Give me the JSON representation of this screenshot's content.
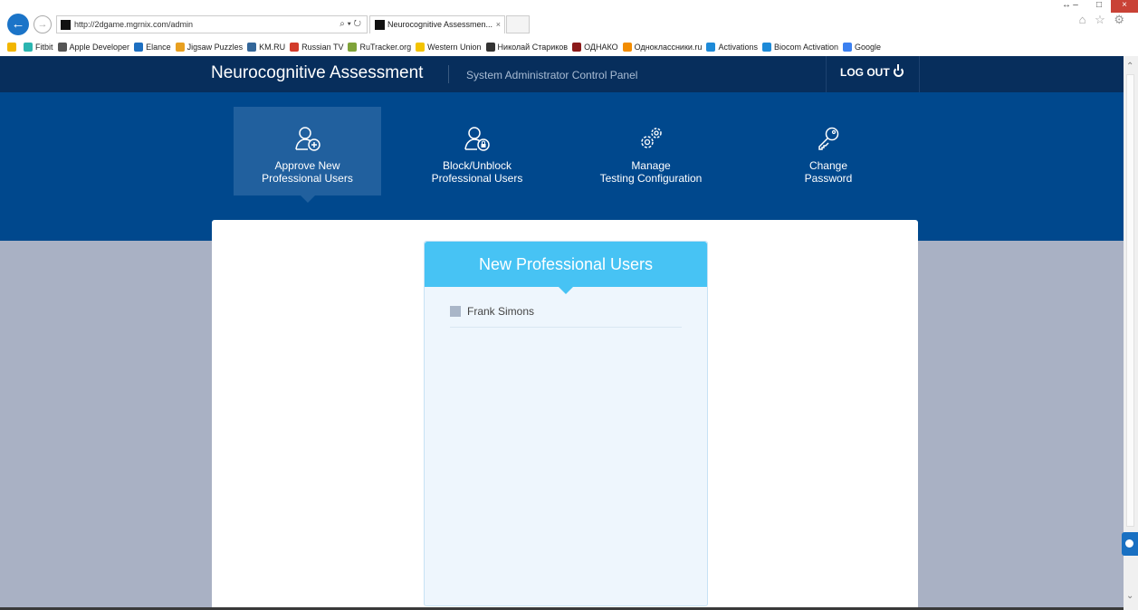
{
  "browser": {
    "address": "http://2dgame.mgrnix.com/admin",
    "address_controls": "⌕ ▾ ↻",
    "tab_title": "Neurocognitive Assessmen...",
    "tab_close": "×",
    "window_min": "–",
    "window_max": "□",
    "window_close": "×",
    "resize": "↔",
    "toolbar_icons": "⌂ ☆ ⚙",
    "favorites": [
      {
        "label": "Fitbit",
        "color": "#2bb5b0"
      },
      {
        "label": "Apple Developer",
        "color": "#555555"
      },
      {
        "label": "Elance",
        "color": "#1d6fc1"
      },
      {
        "label": "Jigsaw Puzzles",
        "color": "#e8a020"
      },
      {
        "label": "KM.RU",
        "color": "#336699"
      },
      {
        "label": "Russian TV",
        "color": "#d23b2b"
      },
      {
        "label": "RuTracker.org",
        "color": "#7fa33a"
      },
      {
        "label": "Western Union",
        "color": "#f3c300"
      },
      {
        "label": "Николай Стариков",
        "color": "#333333"
      },
      {
        "label": "ОДНАКО",
        "color": "#8b1a1a"
      },
      {
        "label": "Одноклассники.ru",
        "color": "#f28c00"
      },
      {
        "label": "Activations",
        "color": "#1d8ad8"
      },
      {
        "label": "Biocom Activation",
        "color": "#1d8ad8"
      },
      {
        "label": "Google",
        "color": "#3b80f0"
      }
    ]
  },
  "header": {
    "brand": "Neurocognitive Assessment",
    "subtitle": "System Administrator Control Panel",
    "logout": "LOG OUT"
  },
  "menu": [
    {
      "line1": "Approve New",
      "line2": "Professional Users",
      "icon": "user-add-icon",
      "active": true
    },
    {
      "line1": "Block/Unblock",
      "line2": "Professional Users",
      "icon": "user-lock-icon",
      "active": false
    },
    {
      "line1": "Manage",
      "line2": "Testing Configuration",
      "icon": "gears-icon",
      "active": false
    },
    {
      "line1": "Change",
      "line2": "Password",
      "icon": "key-icon",
      "active": false
    }
  ],
  "card": {
    "title": "New Professional Users",
    "users": [
      "Frank Simons"
    ]
  },
  "colors": {
    "topnav": "#072e5c",
    "banner": "#00488d",
    "active_item": "#21609e",
    "card_header": "#47c3f4",
    "page_background": "#a9b1c4"
  }
}
